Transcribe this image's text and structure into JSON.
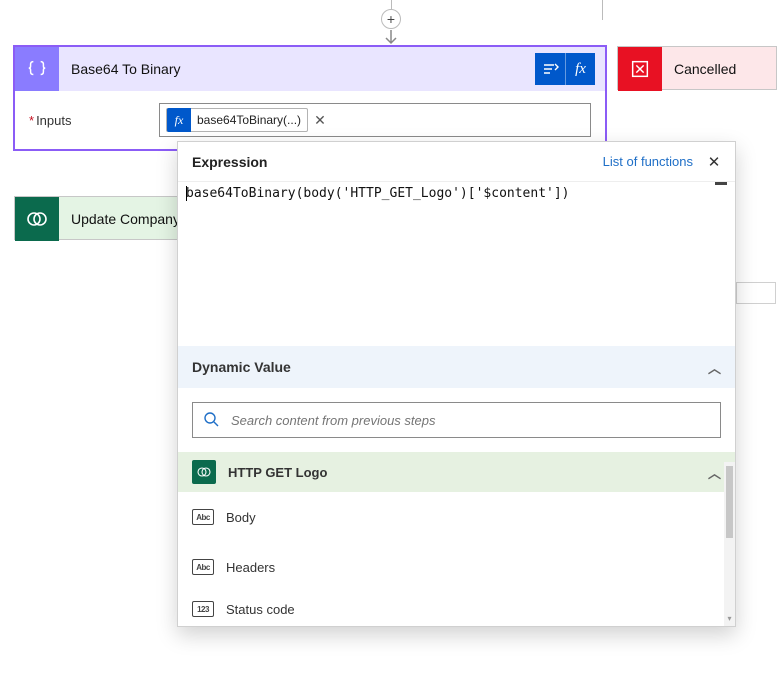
{
  "cards": {
    "base64": {
      "title": "Base64 To Binary",
      "field_label": "Inputs",
      "token_text": "base64ToBinary(...)"
    },
    "cancelled": {
      "title": "Cancelled"
    },
    "update": {
      "title": "Update Company"
    }
  },
  "expression": {
    "label": "Expression",
    "list_link": "List of functions",
    "text": "base64ToBinary(body('HTTP_GET_Logo')['$content'])"
  },
  "dynamic": {
    "header": "Dynamic Value",
    "search_placeholder": "Search content from previous steps",
    "group": {
      "title": "HTTP GET Logo"
    },
    "items": [
      {
        "label": "Body",
        "type": "Abc"
      },
      {
        "label": "Headers",
        "type": "Abc"
      },
      {
        "label": "Status code",
        "type": "123"
      }
    ]
  },
  "icons": {
    "plus_label": "add-step"
  }
}
